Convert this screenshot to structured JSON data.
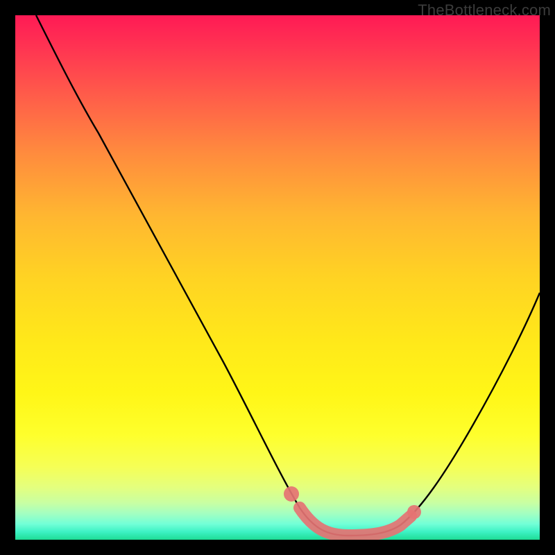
{
  "watermark": "TheBottleneck.com",
  "colors": {
    "curve": "#000000",
    "marker": "#e57373",
    "frame_bg": "#000000"
  },
  "chart_data": {
    "type": "line",
    "title": "",
    "xlabel": "",
    "ylabel": "",
    "xlim": [
      0,
      100
    ],
    "ylim": [
      0,
      100
    ],
    "x_axis_visible": false,
    "y_axis_visible": false,
    "grid": false,
    "legend": false,
    "series": [
      {
        "name": "bottleneck-curve",
        "x": [
          0,
          5,
          10,
          15,
          20,
          25,
          30,
          35,
          40,
          45,
          50,
          52,
          55,
          58,
          60,
          63,
          66,
          70,
          73,
          76,
          80,
          85,
          90,
          95,
          100
        ],
        "y": [
          98,
          95,
          91,
          85,
          78,
          70,
          61,
          51,
          41,
          30,
          19,
          14,
          8,
          4,
          2,
          1,
          1,
          1,
          2,
          4,
          9,
          18,
          30,
          42,
          54
        ]
      }
    ],
    "highlight_range": {
      "name": "optimal-region",
      "x": [
        52,
        55,
        58,
        61,
        64,
        67,
        70,
        73,
        76
      ],
      "y": [
        14,
        8,
        4,
        2,
        1,
        1,
        1,
        2,
        4
      ]
    },
    "background_gradient": {
      "orientation": "vertical",
      "stops": [
        {
          "pos": 0.0,
          "color": "#ff1a55"
        },
        {
          "pos": 0.5,
          "color": "#ffd323"
        },
        {
          "pos": 0.82,
          "color": "#feff2c"
        },
        {
          "pos": 1.0,
          "color": "#1edc95"
        }
      ]
    }
  }
}
